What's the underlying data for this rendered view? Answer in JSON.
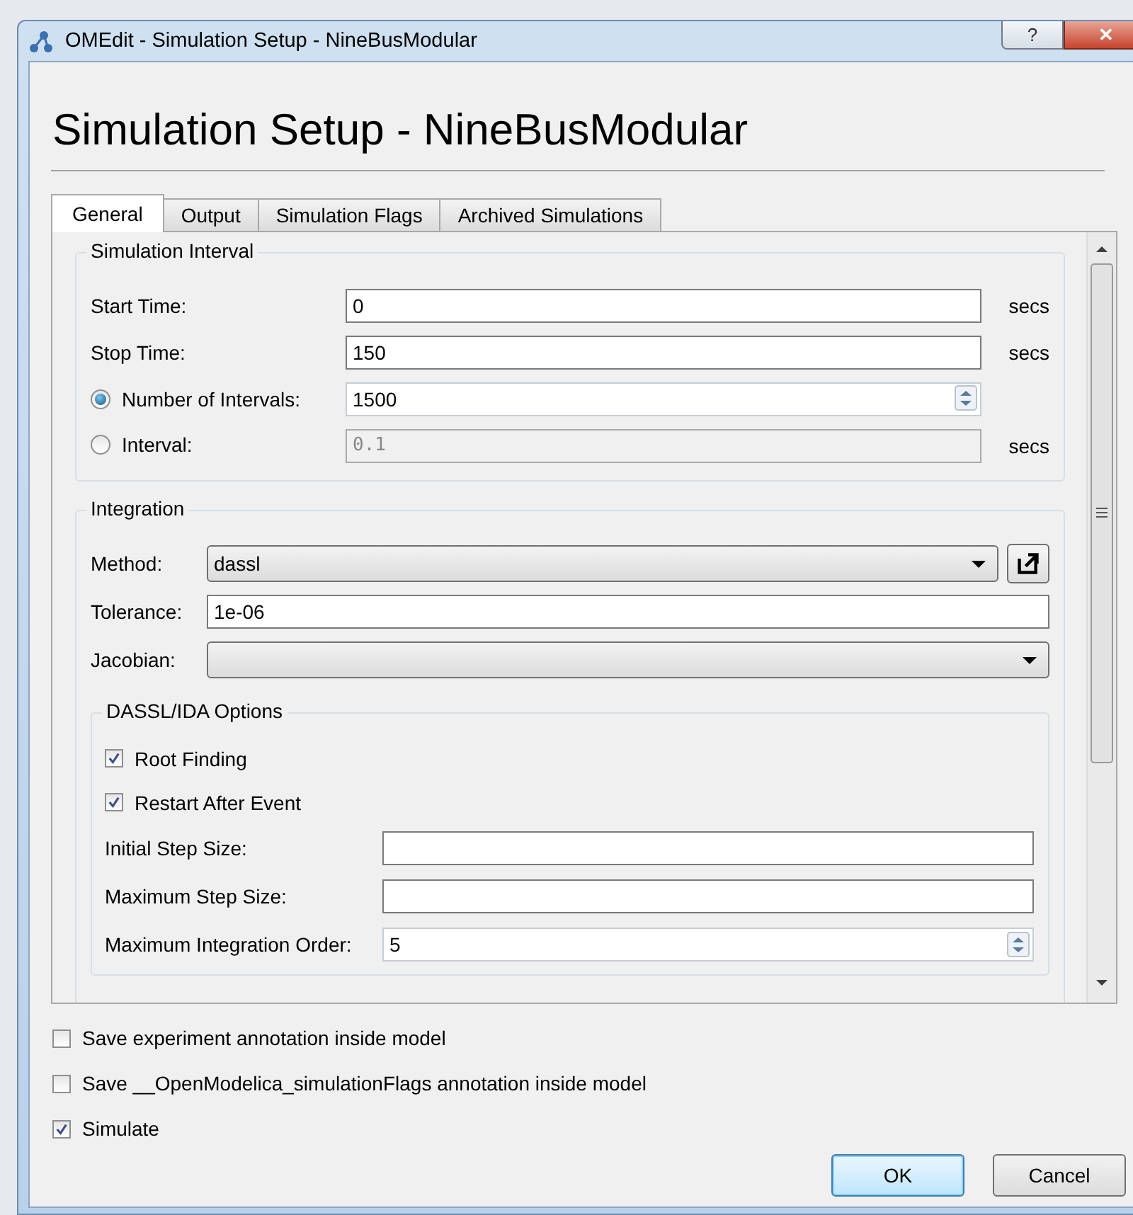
{
  "window": {
    "title": "OMEdit - Simulation Setup - NineBusModular",
    "help": "?",
    "close": "✕"
  },
  "heading": "Simulation Setup - NineBusModular",
  "tabs": [
    {
      "label": "General",
      "selected": true
    },
    {
      "label": "Output",
      "selected": false
    },
    {
      "label": "Simulation Flags",
      "selected": false
    },
    {
      "label": "Archived Simulations",
      "selected": false
    }
  ],
  "simulation_interval": {
    "title": "Simulation Interval",
    "rows": [
      {
        "kind": "field",
        "label": "Start Time:",
        "value": "0",
        "unit": "secs"
      },
      {
        "kind": "field",
        "label": "Stop Time:",
        "value": "150",
        "unit": "secs"
      },
      {
        "kind": "radio-spin",
        "label": "Number of Intervals:",
        "value": "1500",
        "selected": true
      },
      {
        "kind": "radio-field",
        "label": "Interval:",
        "value": "0.1",
        "unit": "secs",
        "selected": false,
        "disabled": true
      }
    ]
  },
  "integration": {
    "title": "Integration",
    "method": {
      "label": "Method:",
      "value": "dassl"
    },
    "tolerance": {
      "label": "Tolerance:",
      "value": "1e-06"
    },
    "jacobian": {
      "label": "Jacobian:"
    },
    "dassl": {
      "title": "DASSL/IDA Options",
      "checks": [
        {
          "label": "Root Finding",
          "checked": true
        },
        {
          "label": "Restart After Event",
          "checked": true
        }
      ],
      "fields": [
        {
          "kind": "field",
          "label": "Initial Step Size:"
        },
        {
          "kind": "field",
          "label": "Maximum Step Size:"
        },
        {
          "kind": "spin",
          "label": "Maximum Integration Order:",
          "value": "5"
        }
      ]
    }
  },
  "options": [
    {
      "label": "Save experiment annotation inside model",
      "checked": false
    },
    {
      "label": "Save __OpenModelica_simulationFlags annotation inside model",
      "checked": false
    },
    {
      "label": "Simulate",
      "checked": true
    }
  ],
  "buttons": [
    {
      "label": "OK",
      "default": true
    },
    {
      "label": "Cancel",
      "default": false
    }
  ]
}
